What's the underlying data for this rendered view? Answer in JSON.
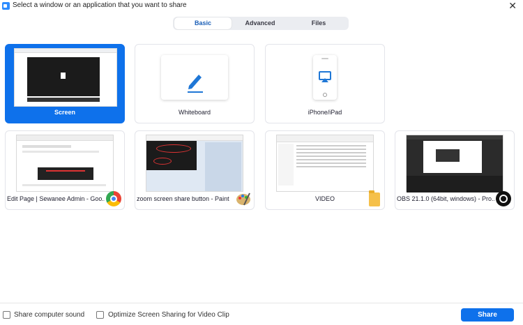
{
  "window": {
    "title": "Select a window or an application that you want to share",
    "close_glyph": "✕"
  },
  "tabs": [
    {
      "label": "Basic",
      "active": true
    },
    {
      "label": "Advanced",
      "active": false
    },
    {
      "label": "Files",
      "active": false
    }
  ],
  "tiles": [
    {
      "label": "Screen",
      "selected": true
    },
    {
      "label": "Whiteboard",
      "icon": "pen-icon"
    },
    {
      "label": "iPhone/iPad",
      "icon": "airplay-icon"
    },
    {
      "label": "Edit Page | Sewanee Admin - Goo...",
      "icon": "chrome-icon"
    },
    {
      "label": "zoom screen share button - Paint",
      "icon": "paint-icon"
    },
    {
      "label": "VIDEO",
      "icon": "folder-icon"
    },
    {
      "label": "OBS 21.1.0 (64bit, windows) - Pro...",
      "icon": "obs-icon"
    }
  ],
  "footer": {
    "share_sound_label": "Share computer sound",
    "optimize_label": "Optimize Screen Sharing for Video Clip",
    "share_button_label": "Share"
  },
  "colors": {
    "accent": "#0e71eb",
    "tab_active_text": "#1b5fb7"
  }
}
